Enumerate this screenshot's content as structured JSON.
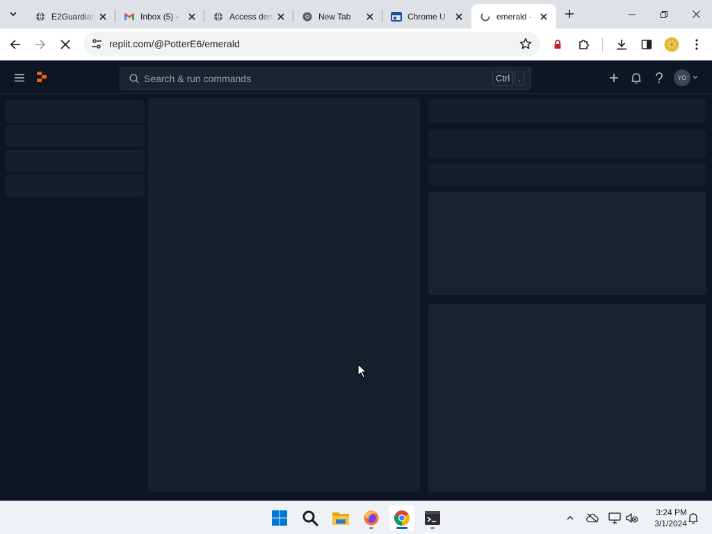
{
  "browser": {
    "tabs": [
      {
        "title": "E2Guardian",
        "favicon": "globe-icon",
        "active": false
      },
      {
        "title": "Inbox (5) - ",
        "favicon": "gmail-icon",
        "active": false
      },
      {
        "title": "Access den",
        "favicon": "globe-icon",
        "active": false
      },
      {
        "title": "New Tab",
        "favicon": "chrome-icon",
        "active": false
      },
      {
        "title": "Chrome U",
        "favicon": "chrome-web-store-icon",
        "active": false
      },
      {
        "title": "emerald - ",
        "favicon": "replit-icon",
        "active": true
      }
    ],
    "url": "replit.com/@PotterE6/emerald",
    "loading": true
  },
  "replit": {
    "search_placeholder": "Search & run commands",
    "shortcut_key_1": "Ctrl",
    "shortcut_key_2": ".",
    "avatar_initials": "YO",
    "brand_color": "#f26207"
  },
  "taskbar": {
    "apps": [
      "start-icon",
      "search-icon",
      "file-explorer-icon",
      "firefox-icon",
      "chrome-icon",
      "terminal-icon"
    ],
    "active_app": "chrome-icon",
    "time": "3:24 PM",
    "date": "3/1/2024"
  }
}
